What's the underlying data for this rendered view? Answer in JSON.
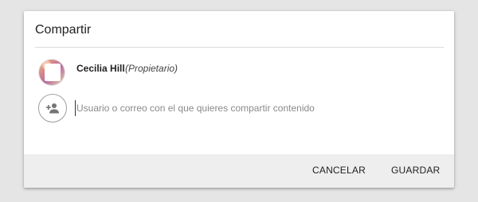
{
  "dialog": {
    "title": "Compartir"
  },
  "owner": {
    "name": "Cecilia Hill",
    "role": "(Propietario)"
  },
  "share": {
    "placeholder": "Usuario o correo con el que quieres compartir contenido",
    "value": "",
    "icon": "person-add-icon"
  },
  "actions": {
    "cancel_label": "CANCELAR",
    "save_label": "GUARDAR"
  },
  "colors": {
    "background": "#e5e5e5",
    "dialog": "#ffffff",
    "footer": "#eeeeee",
    "icon": "#757575"
  }
}
